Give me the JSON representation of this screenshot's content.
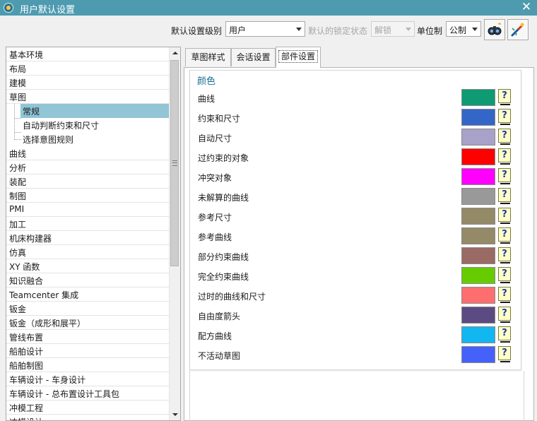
{
  "window": {
    "title": "用户默认设置",
    "close_icon": "close-icon"
  },
  "toolbar": {
    "level_label": "默认设置级别",
    "level_value": "用户",
    "lock_label": "默认的锁定状态",
    "lock_value": "解锁",
    "unit_label": "单位制",
    "unit_value": "公制"
  },
  "nav": {
    "items": [
      {
        "label": "基本环境",
        "sub": false
      },
      {
        "label": "布局",
        "sub": false
      },
      {
        "label": "建模",
        "sub": false
      },
      {
        "label": "草图",
        "sub": false
      },
      {
        "label": "常规",
        "sub": true,
        "selected": true
      },
      {
        "label": "自动判断约束和尺寸",
        "sub": true
      },
      {
        "label": "选择意图规则",
        "sub": true
      },
      {
        "label": "曲线",
        "sub": false
      },
      {
        "label": "分析",
        "sub": false
      },
      {
        "label": "装配",
        "sub": false
      },
      {
        "label": "制图",
        "sub": false
      },
      {
        "label": "PMI",
        "sub": false
      },
      {
        "label": "加工",
        "sub": false
      },
      {
        "label": "机床构建器",
        "sub": false
      },
      {
        "label": "仿真",
        "sub": false
      },
      {
        "label": "XY 函数",
        "sub": false
      },
      {
        "label": "知识融合",
        "sub": false
      },
      {
        "label": "Teamcenter 集成",
        "sub": false
      },
      {
        "label": "钣金",
        "sub": false
      },
      {
        "label": "钣金（成形和展平）",
        "sub": false
      },
      {
        "label": "管线布置",
        "sub": false
      },
      {
        "label": "船舶设计",
        "sub": false
      },
      {
        "label": "船舶制图",
        "sub": false
      },
      {
        "label": "车辆设计 - 车身设计",
        "sub": false
      },
      {
        "label": "车辆设计 - 总布置设计工具包",
        "sub": false
      },
      {
        "label": "冲模工程",
        "sub": false
      },
      {
        "label": "冲模设计",
        "sub": false
      }
    ]
  },
  "tabs": [
    {
      "label": "草图样式",
      "active": false
    },
    {
      "label": "会话设置",
      "active": false
    },
    {
      "label": "部件设置",
      "active": true
    }
  ],
  "colors_section": {
    "title": "颜色",
    "rows": [
      {
        "label": "曲线",
        "color": "#0e9a73"
      },
      {
        "label": "约束和尺寸",
        "color": "#3466c8"
      },
      {
        "label": "自动尺寸",
        "color": "#a8a2c8"
      },
      {
        "label": "过约束的对象",
        "color": "#ff0000"
      },
      {
        "label": "冲突对象",
        "color": "#ff00ff"
      },
      {
        "label": "未解算的曲线",
        "color": "#999999"
      },
      {
        "label": "参考尺寸",
        "color": "#948a68"
      },
      {
        "label": "参考曲线",
        "color": "#948a68"
      },
      {
        "label": "部分约束曲线",
        "color": "#9a6a64"
      },
      {
        "label": "完全约束曲线",
        "color": "#66cc00"
      },
      {
        "label": "过时的曲线和尺寸",
        "color": "#ff6e6e"
      },
      {
        "label": "自由度箭头",
        "color": "#5c4a82"
      },
      {
        "label": "配方曲线",
        "color": "#12b6f0"
      },
      {
        "label": "不活动草图",
        "color": "#4462fa"
      }
    ],
    "help_glyph": "?"
  }
}
